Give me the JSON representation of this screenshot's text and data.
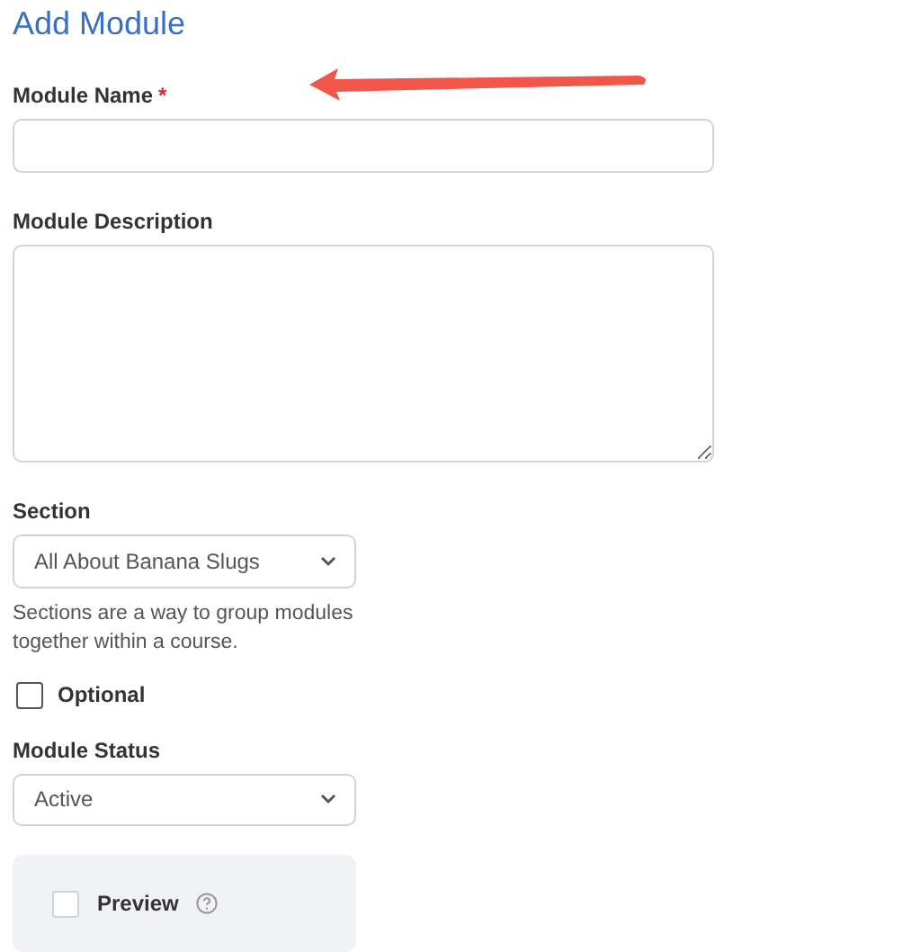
{
  "title": "Add Module",
  "name_field": {
    "label": "Module Name",
    "required_mark": "*"
  },
  "description_field": {
    "label": "Module Description"
  },
  "section_field": {
    "label": "Section",
    "value": "All About Banana Slugs",
    "help": "Sections are a way to group modules together within a course."
  },
  "optional": {
    "label": "Optional",
    "checked": false
  },
  "status_field": {
    "label": "Module Status",
    "value": "Active"
  },
  "preview": {
    "label": "Preview",
    "checked": false
  }
}
